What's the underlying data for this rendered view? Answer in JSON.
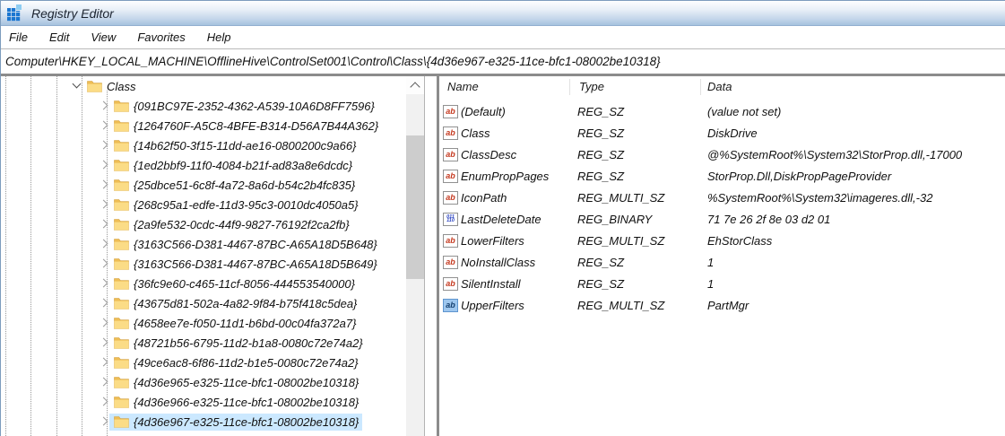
{
  "window": {
    "title": "Registry Editor"
  },
  "menu": {
    "items": [
      "File",
      "Edit",
      "View",
      "Favorites",
      "Help"
    ]
  },
  "address": {
    "path": "Computer\\HKEY_LOCAL_MACHINE\\OfflineHive\\ControlSet001\\Control\\Class\\{4d36e967-e325-11ce-bfc1-08002be10318}"
  },
  "icons": {
    "string_value_glyph": "ab",
    "binary_value_glyph": "011\n110"
  },
  "tree": {
    "parent": {
      "label": "Class",
      "expanded": true
    },
    "children": [
      {
        "label": "{091BC97E-2352-4362-A539-10A6D8FF7596}",
        "selected": false
      },
      {
        "label": "{1264760F-A5C8-4BFE-B314-D56A7B44A362}",
        "selected": false
      },
      {
        "label": "{14b62f50-3f15-11dd-ae16-0800200c9a66}",
        "selected": false
      },
      {
        "label": "{1ed2bbf9-11f0-4084-b21f-ad83a8e6dcdc}",
        "selected": false
      },
      {
        "label": "{25dbce51-6c8f-4a72-8a6d-b54c2b4fc835}",
        "selected": false
      },
      {
        "label": "{268c95a1-edfe-11d3-95c3-0010dc4050a5}",
        "selected": false
      },
      {
        "label": "{2a9fe532-0cdc-44f9-9827-76192f2ca2fb}",
        "selected": false
      },
      {
        "label": "{3163C566-D381-4467-87BC-A65A18D5B648}",
        "selected": false
      },
      {
        "label": "{3163C566-D381-4467-87BC-A65A18D5B649}",
        "selected": false
      },
      {
        "label": "{36fc9e60-c465-11cf-8056-444553540000}",
        "selected": false
      },
      {
        "label": "{43675d81-502a-4a82-9f84-b75f418c5dea}",
        "selected": false
      },
      {
        "label": "{4658ee7e-f050-11d1-b6bd-00c04fa372a7}",
        "selected": false
      },
      {
        "label": "{48721b56-6795-11d2-b1a8-0080c72e74a2}",
        "selected": false
      },
      {
        "label": "{49ce6ac8-6f86-11d2-b1e5-0080c72e74a2}",
        "selected": false
      },
      {
        "label": "{4d36e965-e325-11ce-bfc1-08002be10318}",
        "selected": false
      },
      {
        "label": "{4d36e966-e325-11ce-bfc1-08002be10318}",
        "selected": false
      },
      {
        "label": "{4d36e967-e325-11ce-bfc1-08002be10318}",
        "selected": true
      }
    ]
  },
  "values": {
    "columns": {
      "name": "Name",
      "type": "Type",
      "data": "Data"
    },
    "rows": [
      {
        "icon": "string",
        "icon_selected": false,
        "name": "(Default)",
        "type": "REG_SZ",
        "data": "(value not set)"
      },
      {
        "icon": "string",
        "icon_selected": false,
        "name": "Class",
        "type": "REG_SZ",
        "data": "DiskDrive"
      },
      {
        "icon": "string",
        "icon_selected": false,
        "name": "ClassDesc",
        "type": "REG_SZ",
        "data": "@%SystemRoot%\\System32\\StorProp.dll,-17000"
      },
      {
        "icon": "string",
        "icon_selected": false,
        "name": "EnumPropPages",
        "type": "REG_SZ",
        "data": "StorProp.Dll,DiskPropPageProvider"
      },
      {
        "icon": "string",
        "icon_selected": false,
        "name": "IconPath",
        "type": "REG_MULTI_SZ",
        "data": "%SystemRoot%\\System32\\imageres.dll,-32"
      },
      {
        "icon": "binary",
        "icon_selected": false,
        "name": "LastDeleteDate",
        "type": "REG_BINARY",
        "data": "71 7e 26 2f 8e 03 d2 01"
      },
      {
        "icon": "string",
        "icon_selected": false,
        "name": "LowerFilters",
        "type": "REG_MULTI_SZ",
        "data": "EhStorClass"
      },
      {
        "icon": "string",
        "icon_selected": false,
        "name": "NoInstallClass",
        "type": "REG_SZ",
        "data": "1"
      },
      {
        "icon": "string",
        "icon_selected": false,
        "name": "SilentInstall",
        "type": "REG_SZ",
        "data": "1"
      },
      {
        "icon": "string",
        "icon_selected": true,
        "name": "UpperFilters",
        "type": "REG_MULTI_SZ",
        "data": "PartMgr"
      }
    ]
  },
  "colors": {
    "selection": "#cbe8ff",
    "titlebar_bottom": "#a6c2de",
    "folder": "#fbdc86",
    "string_icon_glyph": "#c5391f",
    "binary_icon_glyph": "#2b43c0"
  }
}
